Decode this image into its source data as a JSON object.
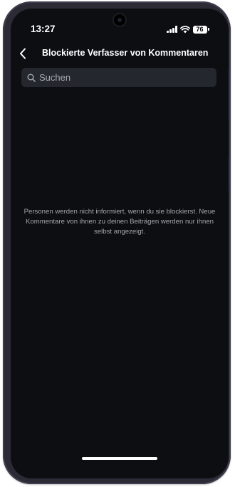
{
  "status_bar": {
    "time": "13:27",
    "battery_level": "76"
  },
  "header": {
    "title": "Blockierte Verfasser von Kommentaren"
  },
  "search": {
    "placeholder": "Suchen"
  },
  "info": {
    "text": "Personen werden nicht informiert, wenn du sie blockierst. Neue Kommentare von ihnen zu deinen Beiträgen werden nur ihnen selbst angezeigt."
  },
  "colors": {
    "background": "#0d0e12",
    "search_field": "#25272e",
    "secondary_text": "#a4a6ad",
    "device_frame": "#2b2a35"
  },
  "icons": {
    "back": "chevron-left-icon",
    "search": "search-icon",
    "signal": "signal-icon",
    "wifi": "wifi-icon",
    "battery": "battery-icon"
  }
}
